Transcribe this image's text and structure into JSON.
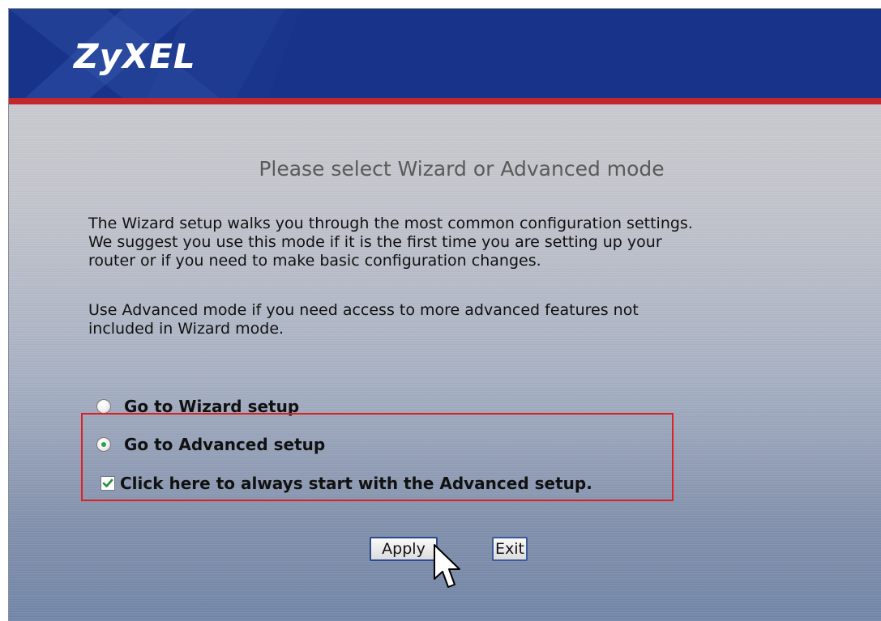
{
  "header": {
    "logo_text": "ZyXEL",
    "colors": {
      "header_bg": "#17338a",
      "accent_bar": "#c2272d"
    }
  },
  "main": {
    "title": "Please select Wizard or Advanced mode",
    "paragraph1": "The Wizard setup walks you through the most common configuration settings.\nWe suggest you use this mode if it is the first time you are setting up your\nrouter or if you need to make basic configuration changes.",
    "paragraph2": "Use Advanced mode if you need access to more advanced features not\nincluded in Wizard mode."
  },
  "options": {
    "wizard": {
      "label": "Go to Wizard setup",
      "checked": false
    },
    "advanced": {
      "label": "Go to Advanced setup",
      "checked": true
    },
    "always_advanced": {
      "label": "Click here to always start with the Advanced setup.",
      "checked": true
    }
  },
  "buttons": {
    "apply": "Apply",
    "exit": "Exit"
  },
  "icons": {
    "radio_icon": "radio-button",
    "checkbox_icon": "check-mark",
    "cursor_icon": "mouse-pointer-arrow"
  }
}
